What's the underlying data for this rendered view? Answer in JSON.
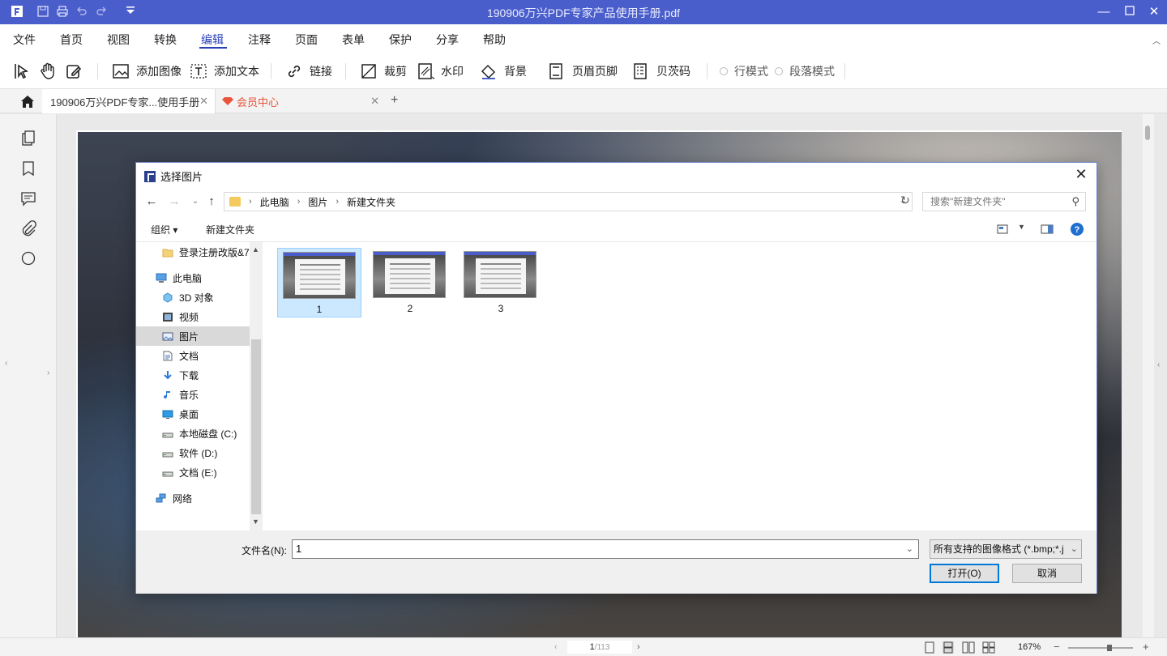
{
  "app": {
    "title": "190906万兴PDF专家产品使用手册.pdf"
  },
  "menu": [
    "文件",
    "首页",
    "视图",
    "转换",
    "编辑",
    "注释",
    "页面",
    "表单",
    "保护",
    "分享",
    "帮助"
  ],
  "menu_active": "编辑",
  "toolbar": {
    "add_image": "添加图像",
    "add_text": "添加文本",
    "link": "链接",
    "crop": "裁剪",
    "watermark": "水印",
    "background": "背景",
    "header_footer": "页眉页脚",
    "bates": "贝茨码",
    "line_mode": "行模式",
    "paragraph_mode": "段落模式"
  },
  "tabs": {
    "doc": "190906万兴PDF专家...使用手册",
    "vip": "会员中心",
    "add": "+"
  },
  "status": {
    "page_current": "1",
    "page_total": "/113",
    "zoom": "167%"
  },
  "dialog": {
    "title": "选择图片",
    "breadcrumb": [
      "此电脑",
      "图片",
      "新建文件夹"
    ],
    "search_placeholder": "搜索\"新建文件夹\"",
    "organize": "组织 ▾",
    "new_folder": "新建文件夹",
    "nav": [
      {
        "label": "登录注册改版&7",
        "icon": "folder-icon"
      },
      {
        "label": "此电脑",
        "icon": "computer-icon"
      },
      {
        "label": "3D 对象",
        "icon": "cube-icon"
      },
      {
        "label": "视频",
        "icon": "video-icon"
      },
      {
        "label": "图片",
        "icon": "pictures-icon"
      },
      {
        "label": "文档",
        "icon": "document-icon"
      },
      {
        "label": "下载",
        "icon": "download-icon"
      },
      {
        "label": "音乐",
        "icon": "music-icon"
      },
      {
        "label": "桌面",
        "icon": "desktop-icon"
      },
      {
        "label": "本地磁盘 (C:)",
        "icon": "drive-icon"
      },
      {
        "label": "软件 (D:)",
        "icon": "drive-icon"
      },
      {
        "label": "文档 (E:)",
        "icon": "drive-icon"
      },
      {
        "label": "网络",
        "icon": "network-icon"
      }
    ],
    "files": [
      {
        "label": "1",
        "selected": true
      },
      {
        "label": "2",
        "selected": false
      },
      {
        "label": "3",
        "selected": false
      }
    ],
    "filename_label": "文件名(N):",
    "filename_value": "1",
    "filter": "所有支持的图像格式 (*.bmp;*.j",
    "open": "打开(O)",
    "cancel": "取消"
  }
}
